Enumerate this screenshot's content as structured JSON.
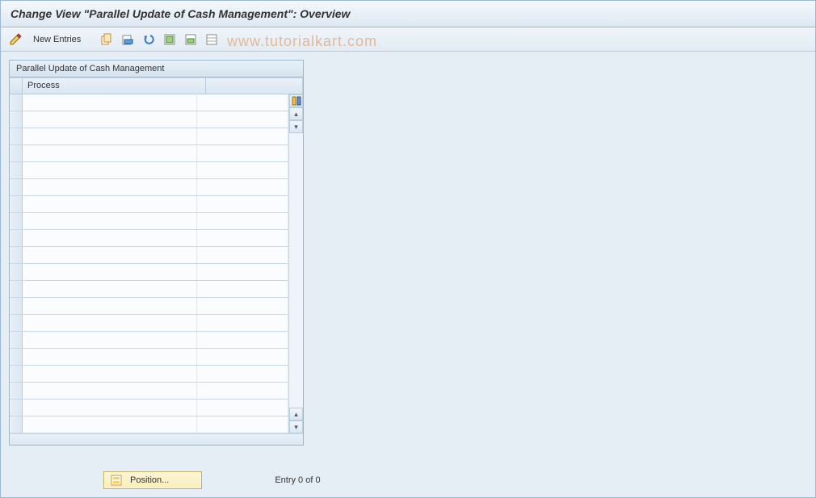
{
  "title": "Change View \"Parallel Update of Cash Management\": Overview",
  "toolbar": {
    "new_entries_label": "New Entries"
  },
  "panel": {
    "title": "Parallel Update of Cash Management",
    "column_process": "Process",
    "rows": [
      "",
      "",
      "",
      "",
      "",
      "",
      "",
      "",
      "",
      "",
      "",
      "",
      "",
      "",
      "",
      "",
      "",
      "",
      "",
      ""
    ]
  },
  "footer": {
    "position_label": "Position...",
    "entry_status": "Entry 0 of 0"
  },
  "watermark": "www.tutorialkart.com"
}
